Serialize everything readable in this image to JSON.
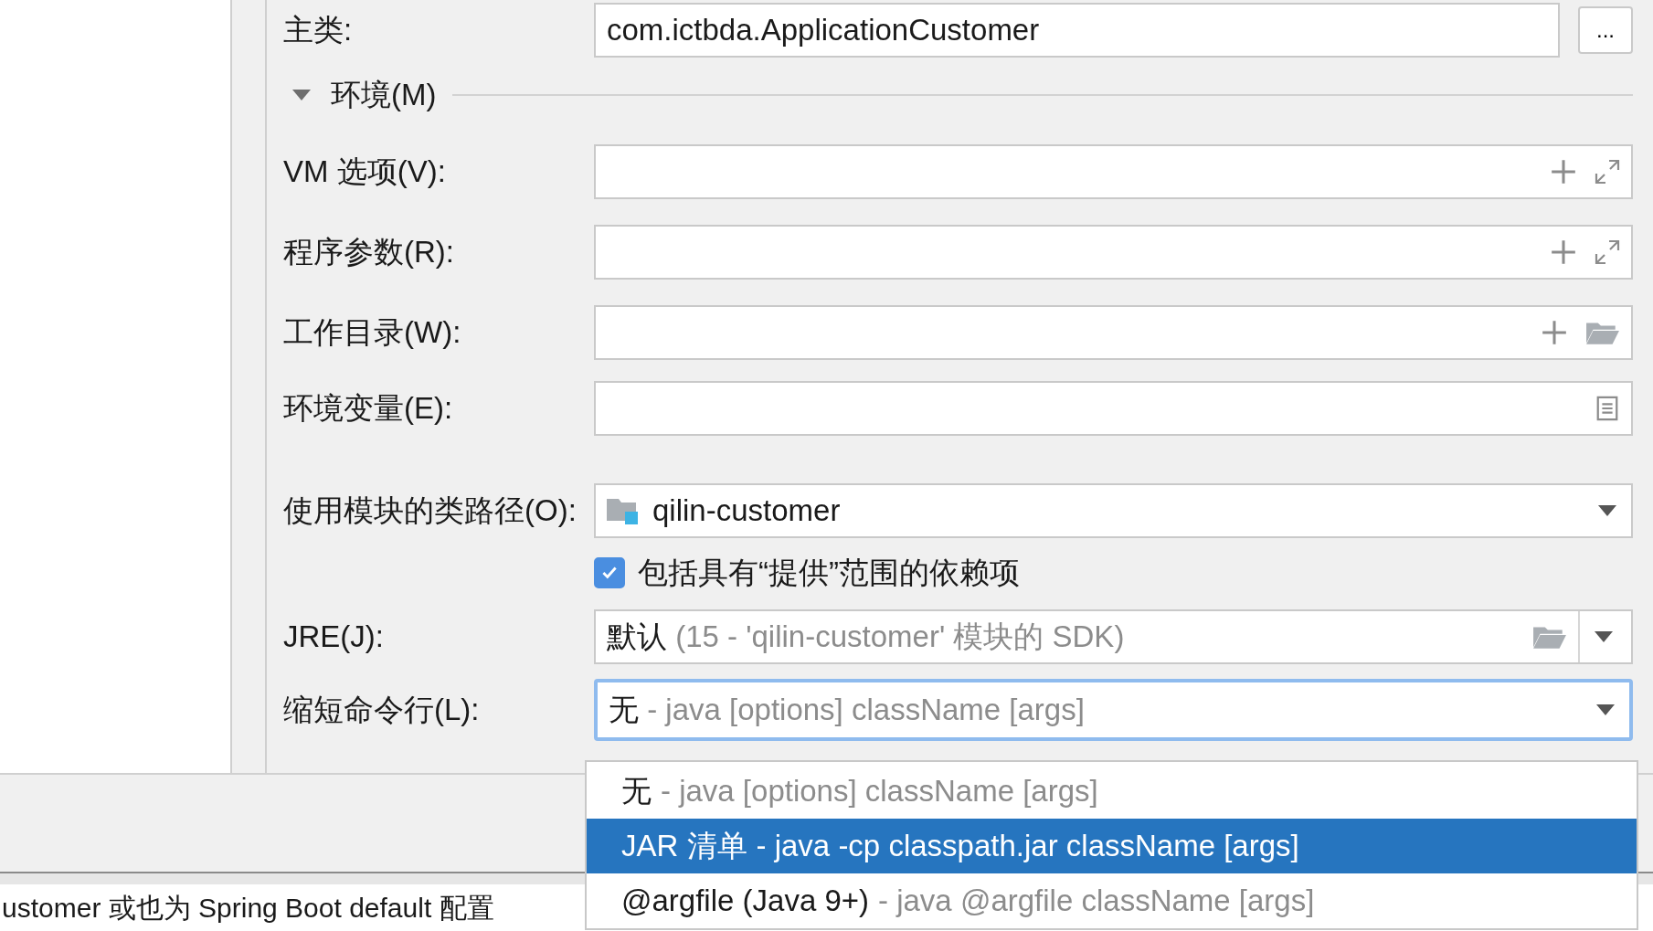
{
  "main_class": {
    "label": "主类:",
    "value": "com.ictbda.ApplicationCustomer",
    "browse_button": "..."
  },
  "section": {
    "title": "环境(M)",
    "expanded": true
  },
  "fields": [
    {
      "label": "VM 选项(V):",
      "kind": "expand"
    },
    {
      "label": "程序参数(R):",
      "kind": "expand"
    },
    {
      "label": "工作目录(W):",
      "kind": "folder"
    },
    {
      "label": "环境变量(E):",
      "kind": "list"
    }
  ],
  "module": {
    "label": "使用模块的类路径(O):",
    "value": "qilin-customer"
  },
  "include_provided": {
    "label": "包括具有“提供”范围的依赖项",
    "checked": true
  },
  "jre": {
    "label": "JRE(J):",
    "value": "默认",
    "hint": "(15 - 'qilin-customer' 模块的 SDK)"
  },
  "shorten": {
    "label": "缩短命令行(L):",
    "value": "无",
    "hint": "- java [options] className [args]",
    "focused": true
  },
  "dropdown": [
    {
      "name": "无",
      "hint": "- java [options] className [args]",
      "selected": false
    },
    {
      "name": "JAR 清单",
      "hint": "- java -cp classpath.jar className [args]",
      "selected": true
    },
    {
      "name": "@argfile (Java 9+)",
      "hint": "- java @argfile className [args]",
      "selected": false
    }
  ],
  "background_text": "ustomer 或也为 Spring Boot default 配置"
}
